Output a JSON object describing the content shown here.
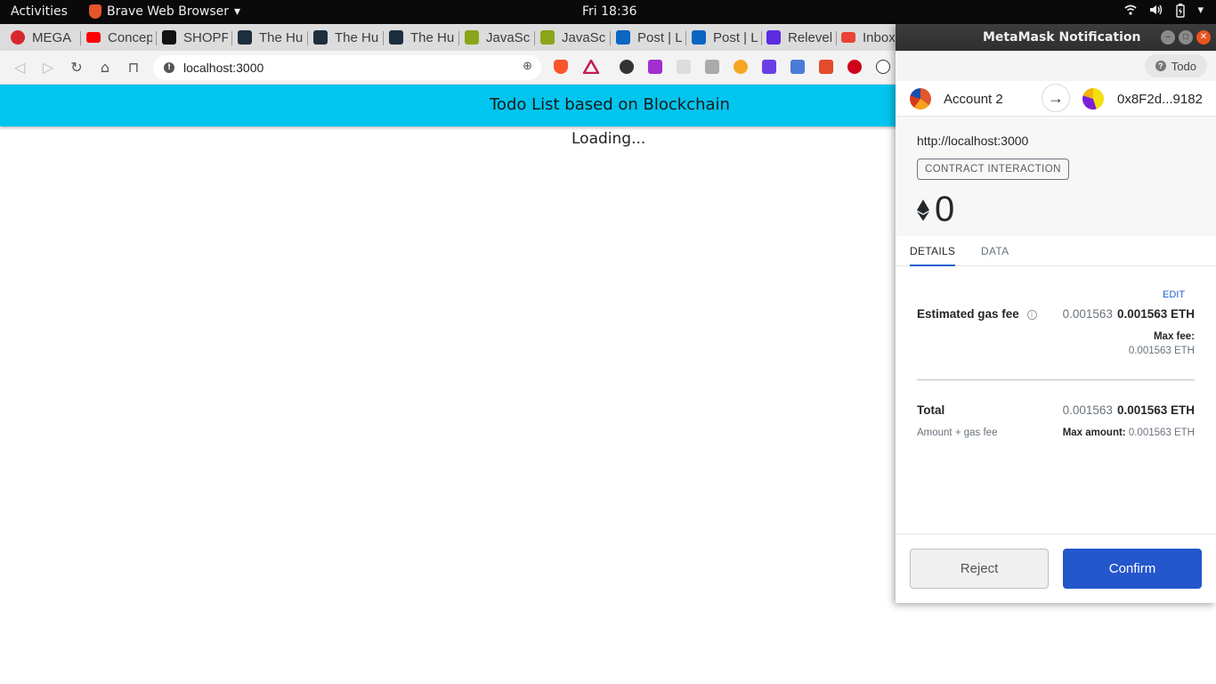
{
  "topbar": {
    "activities": "Activities",
    "app_name": "Brave Web Browser",
    "clock": "Fri 18:36"
  },
  "tabs": [
    {
      "label": "MEGA",
      "color": "#d9272e"
    },
    {
      "label": "Concep",
      "color": "#ff0000"
    },
    {
      "label": "SHOPP",
      "color": "#111111"
    },
    {
      "label": "The Hu",
      "color": "#1d2f3f"
    },
    {
      "label": "The Hu",
      "color": "#1d2f3f"
    },
    {
      "label": "The Hu",
      "color": "#1d2f3f"
    },
    {
      "label": "JavaSc",
      "color": "#8aa51a"
    },
    {
      "label": "JavaSc",
      "color": "#8aa51a"
    },
    {
      "label": "Post | L",
      "color": "#0a66c2"
    },
    {
      "label": "Post | L",
      "color": "#0a66c2"
    },
    {
      "label": "Relevel",
      "color": "#5b2be0"
    },
    {
      "label": "Inbox",
      "color": "#ea4335"
    }
  ],
  "address_bar": {
    "url": "localhost:3000"
  },
  "page": {
    "header_title": "Todo List based on Blockchain",
    "loading": "Loading..."
  },
  "metamask": {
    "window_title": "MetaMask Notification",
    "network_label": "Todo",
    "from_account": "Account 2",
    "to_address": "0x8F2d...9182",
    "origin": "http://localhost:3000",
    "badge": "CONTRACT INTERACTION",
    "amount": "0",
    "tab_details": "DETAILS",
    "tab_data": "DATA",
    "edit": "EDIT",
    "gas_label": "Estimated gas fee",
    "gas_value_light": "0.001563",
    "gas_value_bold": "0.001563 ETH",
    "max_fee_label": "Max fee:",
    "max_fee_value": "0.001563 ETH",
    "total_label": "Total",
    "total_value_light": "0.001563",
    "total_value_bold": "0.001563 ETH",
    "total_sub_label": "Amount + gas fee",
    "max_amount_label": "Max amount:",
    "max_amount_value": "0.001563 ETH",
    "reject": "Reject",
    "confirm": "Confirm"
  },
  "colors": {
    "page_header": "#00c5ee",
    "confirm_button": "#2456cc",
    "link_blue": "#1f5fd0"
  },
  "icons": [
    "brave-lion-icon",
    "wifi-icon",
    "volume-icon",
    "battery-icon",
    "back-icon",
    "forward-icon",
    "reload-icon",
    "home-icon",
    "bookmark-icon",
    "site-info-icon",
    "zoom-icon",
    "brave-shields-icon",
    "brave-rewards-icon",
    "ethereum-icon",
    "arrow-right-icon",
    "info-icon"
  ]
}
